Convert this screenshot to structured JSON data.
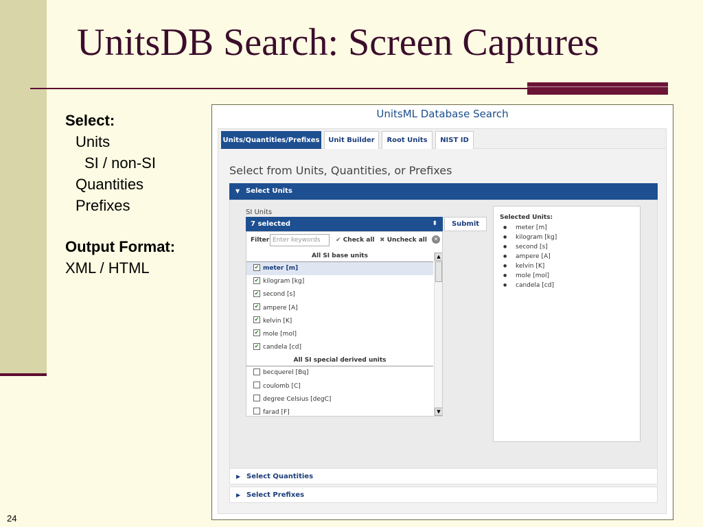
{
  "slide": {
    "title": "UnitsDB Search: Screen Captures",
    "number": "24",
    "bullets": {
      "select_heading": "Select:",
      "units": "Units",
      "si": "SI / non-SI",
      "quantities": "Quantities",
      "prefixes": "Prefixes",
      "output_heading": "Output Format:",
      "output_value": "XML / HTML"
    },
    "colors": {
      "background": "#fdfbe3",
      "accent": "#5d0d30",
      "side_bar": "#d8d5a8"
    }
  },
  "app": {
    "title": "UnitsML Database Search",
    "tabs": [
      {
        "label": "Units/Quantities/Prefixes",
        "active": true
      },
      {
        "label": "Unit Builder",
        "active": false
      },
      {
        "label": "Root Units",
        "active": false
      },
      {
        "label": "NIST ID",
        "active": false
      }
    ],
    "heading": "Select from Units, Quantities, or Prefixes",
    "accordion": {
      "select_units": "Select Units",
      "select_quantities": "Select Quantities",
      "select_prefixes": "Select Prefixes"
    },
    "si_units_label": "SI Units",
    "select_value": "7 selected",
    "submit_label": "Submit",
    "filter": {
      "label": "Filter:",
      "placeholder": "Enter keywords",
      "check_all": "Check all",
      "uncheck_all": "Uncheck all"
    },
    "groups": [
      {
        "header": "All SI base units",
        "items": [
          {
            "label": "meter [m]",
            "checked": true
          },
          {
            "label": "kilogram [kg]",
            "checked": true
          },
          {
            "label": "second [s]",
            "checked": true
          },
          {
            "label": "ampere [A]",
            "checked": true
          },
          {
            "label": "kelvin [K]",
            "checked": true
          },
          {
            "label": "mole [mol]",
            "checked": true
          },
          {
            "label": "candela [cd]",
            "checked": true
          }
        ]
      },
      {
        "header": "All SI special derived units",
        "items": [
          {
            "label": "becquerel [Bq]",
            "checked": false
          },
          {
            "label": "coulomb [C]",
            "checked": false
          },
          {
            "label": "degree Celsius [degC]",
            "checked": false
          },
          {
            "label": "farad [F]",
            "checked": false
          }
        ]
      }
    ],
    "selected_title": "Selected Units:",
    "selected_units": [
      "meter [m]",
      "kilogram [kg]",
      "second [s]",
      "ampere [A]",
      "kelvin [K]",
      "mole [mol]",
      "candela [cd]"
    ],
    "colors": {
      "primary": "#1d4f91",
      "title": "#1b4d8c"
    }
  }
}
